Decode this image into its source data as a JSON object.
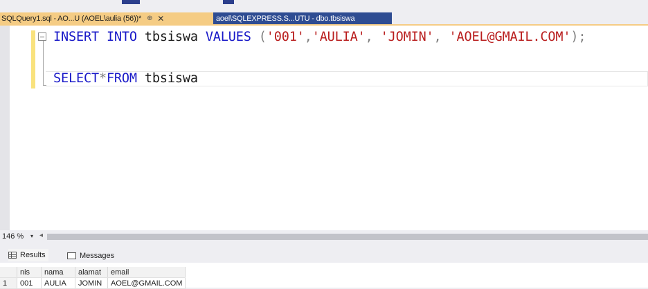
{
  "tabs": {
    "active": {
      "title": "SQLQuery1.sql - AO...U (AOEL\\aulia (56))*",
      "pin": "⊕",
      "close": "✕"
    },
    "inactive": {
      "title": "aoel\\SQLEXPRESS.S...UTU - dbo.tbsiswa"
    }
  },
  "editor": {
    "line1": {
      "kw1": "INSERT",
      "kw2": "INTO",
      "table": "tbsiswa",
      "kw3": "VALUES",
      "open": "(",
      "v1": "'001'",
      "c1": ",",
      "v2": "'AULIA'",
      "c2": ",",
      "v3": "'JOMIN'",
      "c3": ",",
      "v4": "'AOEL@GMAIL.COM'",
      "close": ");"
    },
    "line2": {
      "kw1": "SELECT",
      "star": "*",
      "kw2": "FROM",
      "table": "tbsiswa"
    }
  },
  "zoom": {
    "level": "146 %",
    "dropdown_arrow": "▾",
    "scroll_left": "◂"
  },
  "results_tabs": {
    "results": "Results",
    "messages": "Messages"
  },
  "grid": {
    "columns": [
      "nis",
      "nama",
      "alamat",
      "email"
    ],
    "rows": [
      {
        "row_number": "1",
        "cells": [
          "001",
          "AULIA",
          "JOMIN",
          "AOEL@GMAIL.COM"
        ]
      }
    ]
  },
  "colors": {
    "active_tab": "#f5cc84",
    "inactive_tab": "#2e4c92",
    "keyword": "#1818c8",
    "string": "#b91e1e"
  }
}
